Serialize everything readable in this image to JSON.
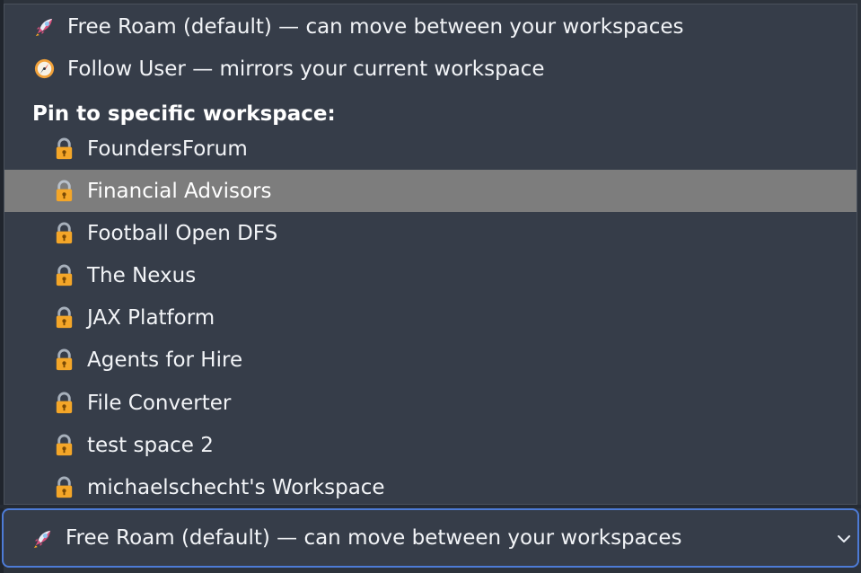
{
  "dropdown": {
    "options": {
      "free_roam": "Free Roam (default) — can move between your workspaces",
      "follow_user": "Follow User — mirrors your current workspace"
    },
    "group_label": "Pin to specific workspace:",
    "workspaces": [
      "FoundersForum",
      "Financial Advisors",
      "Football Open DFS",
      "The Nexus",
      "JAX Platform",
      "Agents for Hire",
      "File Converter",
      "test space 2",
      "michaelschecht's Workspace"
    ],
    "highlighted_workspace": "Financial Advisors"
  },
  "select": {
    "value": "Free Roam (default) — can move between your workspaces"
  },
  "icons": {
    "free_roam": "rocket-icon",
    "follow_user": "compass-icon",
    "workspace": "lock-icon",
    "select_toggle": "chevron-down-icon"
  },
  "colors": {
    "background": "#363d49",
    "highlight": "#7d7d7d",
    "focus_border": "#4d7bd6",
    "lock": "#f4a628",
    "rocket": "#d84f7c"
  }
}
